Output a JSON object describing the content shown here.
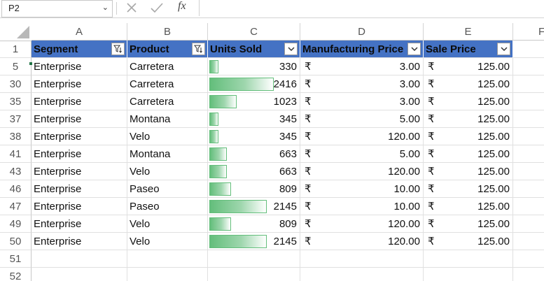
{
  "formula_bar": {
    "name_box": "P2",
    "name_box_caret_icon": "chevron-down-icon",
    "cancel_icon": "close-icon",
    "enter_icon": "checkmark-icon",
    "fx_label": "fx",
    "formula": ""
  },
  "columns": [
    "A",
    "B",
    "C",
    "D",
    "E",
    "F"
  ],
  "header_row": {
    "row_number": "1",
    "cells": [
      "Segment",
      "Product",
      "Units Sold",
      "Manufacturing Price",
      "Sale Price"
    ],
    "filter_icons": [
      "filter-active-icon",
      "filter-active-icon",
      "dropdown-icon",
      "dropdown-icon",
      "dropdown-icon"
    ]
  },
  "rows": [
    {
      "row_number": "5",
      "segment": "Enterprise",
      "product": "Carretera",
      "units_sold": "330",
      "units_fraction": 0.137,
      "mfg_currency": "₹",
      "mfg_price": "3.00",
      "sale_currency": "₹",
      "sale_price": "125.00"
    },
    {
      "row_number": "30",
      "segment": "Enterprise",
      "product": "Carretera",
      "units_sold": "2416",
      "units_fraction": 1.0,
      "mfg_currency": "₹",
      "mfg_price": "3.00",
      "sale_currency": "₹",
      "sale_price": "125.00"
    },
    {
      "row_number": "35",
      "segment": "Enterprise",
      "product": "Carretera",
      "units_sold": "1023",
      "units_fraction": 0.423,
      "mfg_currency": "₹",
      "mfg_price": "3.00",
      "sale_currency": "₹",
      "sale_price": "125.00"
    },
    {
      "row_number": "37",
      "segment": "Enterprise",
      "product": "Montana",
      "units_sold": "345",
      "units_fraction": 0.143,
      "mfg_currency": "₹",
      "mfg_price": "5.00",
      "sale_currency": "₹",
      "sale_price": "125.00"
    },
    {
      "row_number": "38",
      "segment": "Enterprise",
      "product": "Velo",
      "units_sold": "345",
      "units_fraction": 0.143,
      "mfg_currency": "₹",
      "mfg_price": "120.00",
      "sale_currency": "₹",
      "sale_price": "125.00"
    },
    {
      "row_number": "41",
      "segment": "Enterprise",
      "product": "Montana",
      "units_sold": "663",
      "units_fraction": 0.274,
      "mfg_currency": "₹",
      "mfg_price": "5.00",
      "sale_currency": "₹",
      "sale_price": "125.00"
    },
    {
      "row_number": "43",
      "segment": "Enterprise",
      "product": "Velo",
      "units_sold": "663",
      "units_fraction": 0.274,
      "mfg_currency": "₹",
      "mfg_price": "120.00",
      "sale_currency": "₹",
      "sale_price": "125.00"
    },
    {
      "row_number": "46",
      "segment": "Enterprise",
      "product": "Paseo",
      "units_sold": "809",
      "units_fraction": 0.335,
      "mfg_currency": "₹",
      "mfg_price": "10.00",
      "sale_currency": "₹",
      "sale_price": "125.00"
    },
    {
      "row_number": "47",
      "segment": "Enterprise",
      "product": "Paseo",
      "units_sold": "2145",
      "units_fraction": 0.888,
      "mfg_currency": "₹",
      "mfg_price": "10.00",
      "sale_currency": "₹",
      "sale_price": "125.00"
    },
    {
      "row_number": "49",
      "segment": "Enterprise",
      "product": "Velo",
      "units_sold": "809",
      "units_fraction": 0.335,
      "mfg_currency": "₹",
      "mfg_price": "120.00",
      "sale_currency": "₹",
      "sale_price": "125.00"
    },
    {
      "row_number": "50",
      "segment": "Enterprise",
      "product": "Velo",
      "units_sold": "2145",
      "units_fraction": 0.888,
      "mfg_currency": "₹",
      "mfg_price": "120.00",
      "sale_currency": "₹",
      "sale_price": "125.00"
    }
  ],
  "empty_rows": [
    "51",
    "52"
  ],
  "colors": {
    "header_fill": "#4472c4",
    "data_bar": "#63be7b",
    "gridline": "#e0e0e0"
  }
}
